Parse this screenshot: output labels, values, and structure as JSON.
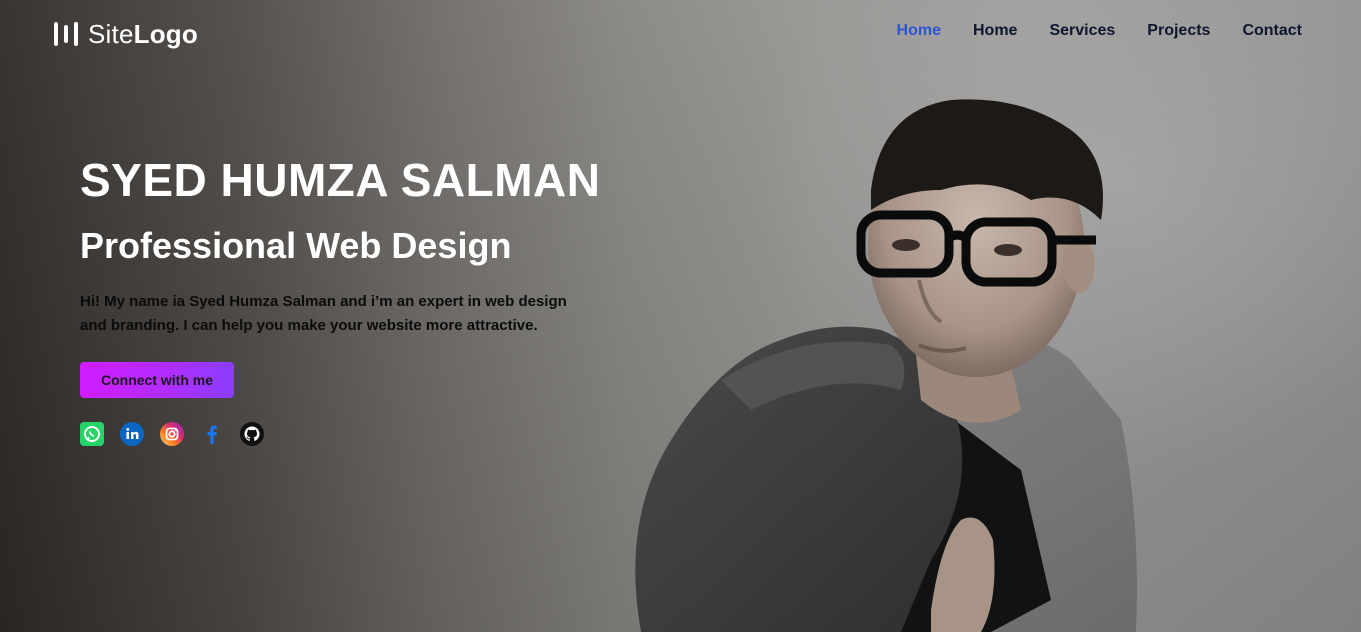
{
  "logo": {
    "text_light": "Site",
    "text_bold": "Logo"
  },
  "nav": {
    "items": [
      {
        "label": "Home",
        "active": true
      },
      {
        "label": "Home",
        "active": false
      },
      {
        "label": "Services",
        "active": false
      },
      {
        "label": "Projects",
        "active": false
      },
      {
        "label": "Contact",
        "active": false
      }
    ],
    "active_color": "#2f54d6",
    "text_color": "#0f1730"
  },
  "hero": {
    "name": "SYED HUMZA SALMAN",
    "tagline": "Professional Web Design",
    "intro": "Hi! My name ia Syed Humza Salman and i’m an expert in web design and branding. I can help you make your website more attractive.",
    "cta_label": "Connect with me",
    "cta_gradient": [
      "#d21bff",
      "#8a3dff"
    ]
  },
  "social": [
    {
      "icon": "whatsapp-icon",
      "color": "#25d366"
    },
    {
      "icon": "linkedin-icon",
      "color": "#0a66c2"
    },
    {
      "icon": "instagram-icon",
      "color": "#e1306c"
    },
    {
      "icon": "facebook-icon",
      "color": "#1877f2"
    },
    {
      "icon": "github-icon",
      "color": "#111111"
    }
  ]
}
